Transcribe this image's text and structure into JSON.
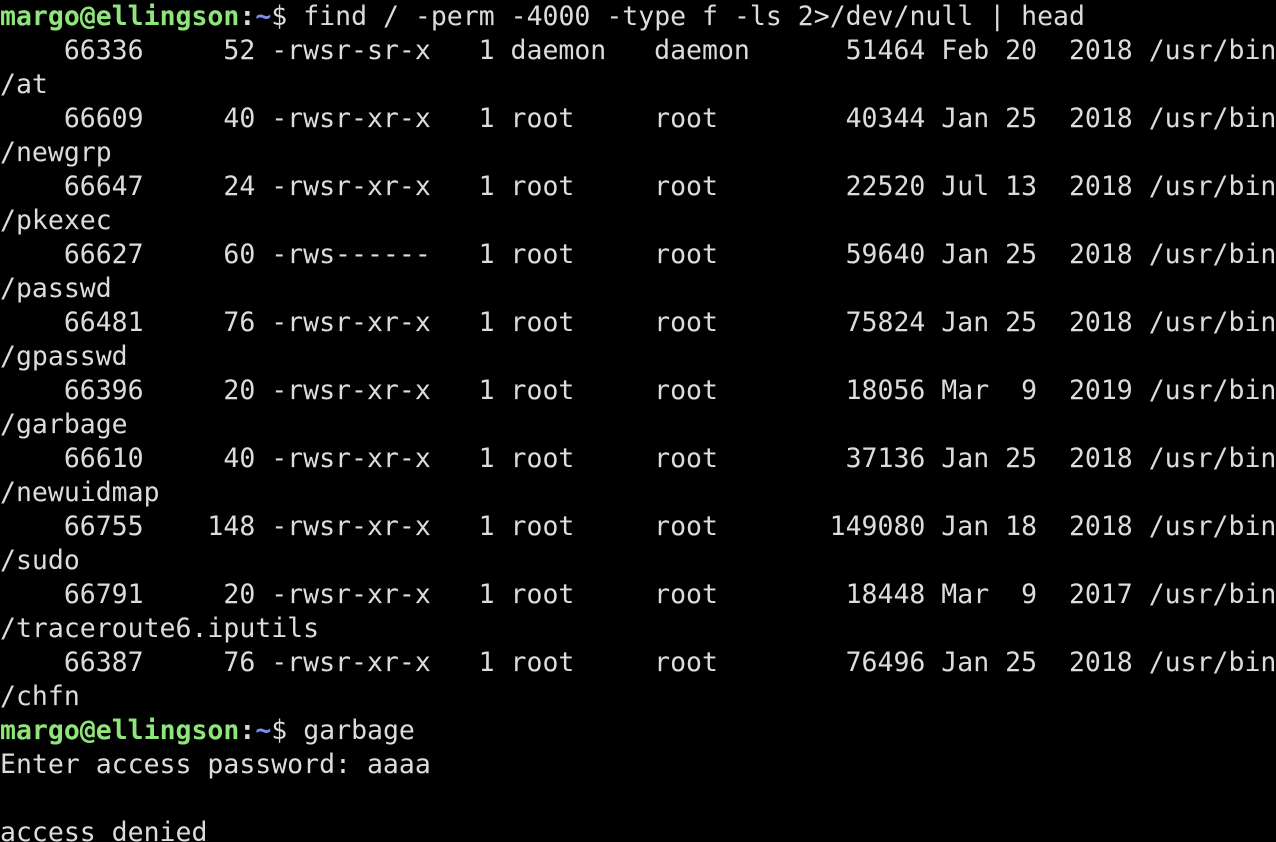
{
  "prompt": {
    "user": "margo",
    "at": "@",
    "host": "ellingson",
    "colon": ":",
    "path": "~",
    "dollar": "$ "
  },
  "commands": {
    "find": "find / -perm -4000 -type f -ls 2>/dev/null | head",
    "garbage": "garbage"
  },
  "listing": [
    {
      "row": "    66336     52 -rwsr-sr-x   1 daemon   daemon      51464 Feb 20  2018 /usr/bin",
      "wrap": "/at"
    },
    {
      "row": "    66609     40 -rwsr-xr-x   1 root     root        40344 Jan 25  2018 /usr/bin",
      "wrap": "/newgrp"
    },
    {
      "row": "    66647     24 -rwsr-xr-x   1 root     root        22520 Jul 13  2018 /usr/bin",
      "wrap": "/pkexec"
    },
    {
      "row": "    66627     60 -rws------   1 root     root        59640 Jan 25  2018 /usr/bin",
      "wrap": "/passwd"
    },
    {
      "row": "    66481     76 -rwsr-xr-x   1 root     root        75824 Jan 25  2018 /usr/bin",
      "wrap": "/gpasswd"
    },
    {
      "row": "    66396     20 -rwsr-xr-x   1 root     root        18056 Mar  9  2019 /usr/bin",
      "wrap": "/garbage"
    },
    {
      "row": "    66610     40 -rwsr-xr-x   1 root     root        37136 Jan 25  2018 /usr/bin",
      "wrap": "/newuidmap"
    },
    {
      "row": "    66755    148 -rwsr-xr-x   1 root     root       149080 Jan 18  2018 /usr/bin",
      "wrap": "/sudo"
    },
    {
      "row": "    66791     20 -rwsr-xr-x   1 root     root        18448 Mar  9  2017 /usr/bin",
      "wrap": "/traceroute6.iputils"
    },
    {
      "row": "    66387     76 -rwsr-xr-x   1 root     root        76496 Jan 25  2018 /usr/bin",
      "wrap": "/chfn"
    }
  ],
  "output": {
    "password_prompt": "Enter access password: aaaa",
    "blank": "",
    "denied": "access denied"
  },
  "colors": {
    "background": "#000000",
    "foreground": "#dcdcdc",
    "prompt_user_host": "#8ee57a",
    "prompt_path": "#7b8ff0"
  }
}
